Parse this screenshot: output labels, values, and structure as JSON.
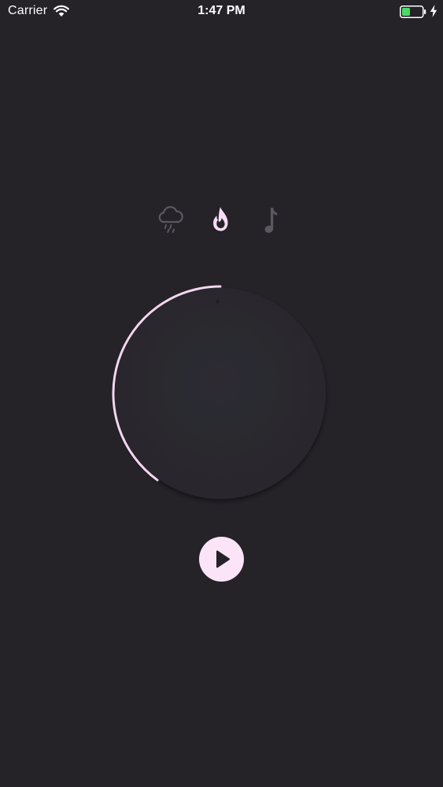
{
  "status_bar": {
    "carrier": "Carrier",
    "time": "1:47 PM",
    "battery_color": "#4cd964"
  },
  "modes": {
    "items": [
      {
        "id": "rain",
        "icon": "rain-cloud-icon",
        "active": false
      },
      {
        "id": "fire",
        "icon": "flame-icon",
        "active": true
      },
      {
        "id": "music",
        "icon": "music-note-icon",
        "active": false
      }
    ],
    "active_color": "#f7dcf5",
    "inactive_color": "#5b5860"
  },
  "timer_dial": {
    "progress_fraction": 0.4,
    "accent_color": "#f3d6ef",
    "face_color": "#2b292f"
  },
  "play_button": {
    "icon": "play-icon",
    "color": "#fbe4f8"
  }
}
